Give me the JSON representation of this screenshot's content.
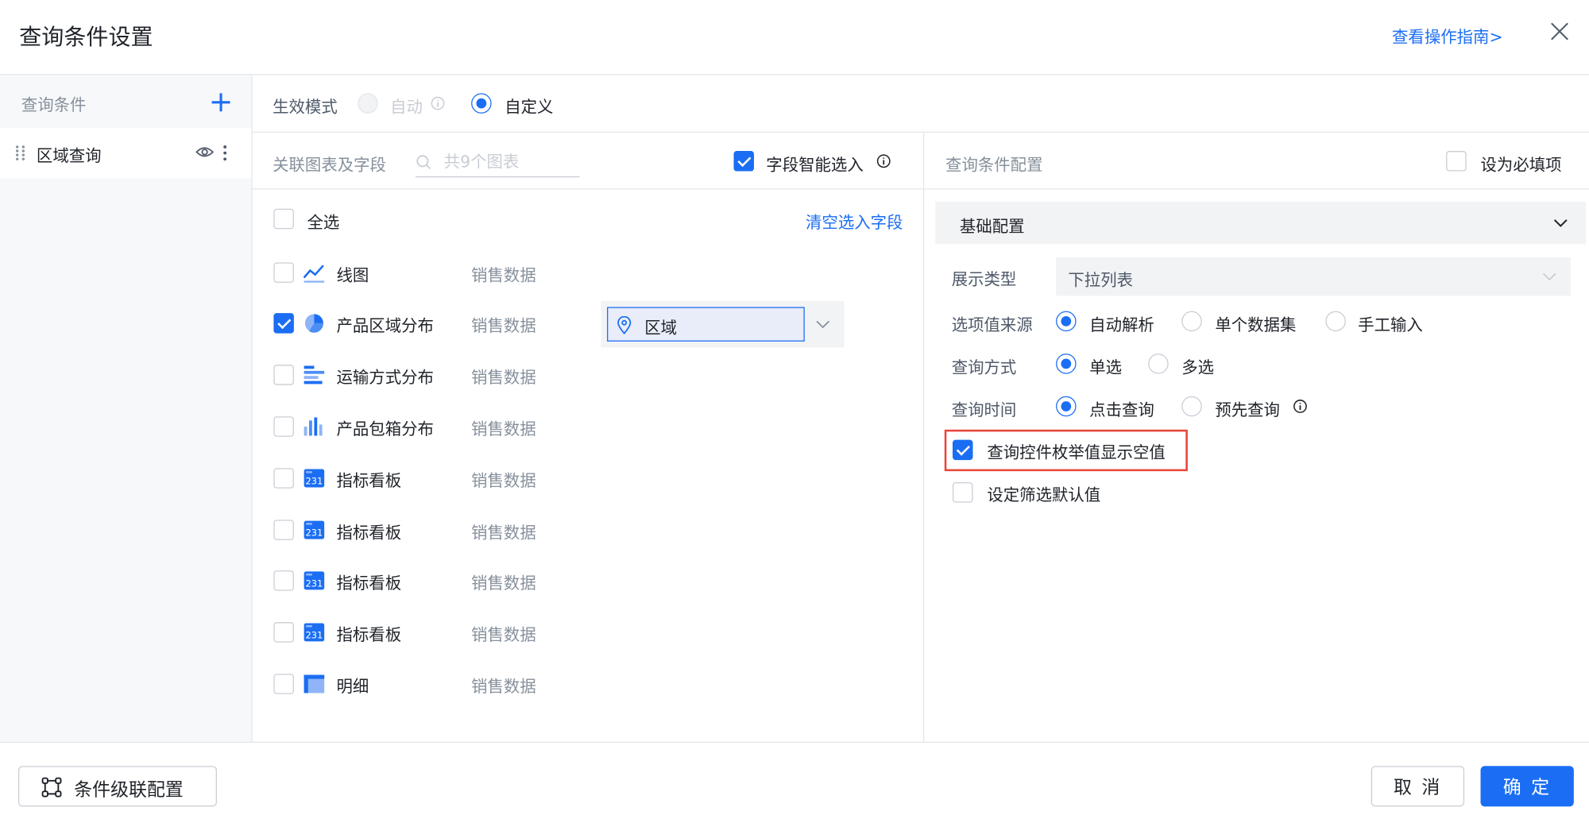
{
  "dialog": {
    "title": "查询条件设置",
    "guide_link": "查看操作指南>"
  },
  "sidebar": {
    "header": "查询条件",
    "items": [
      {
        "label": "区域查询"
      }
    ]
  },
  "mode": {
    "label": "生效模式",
    "options": [
      {
        "label": "自动",
        "disabled": true
      },
      {
        "label": "自定义",
        "selected": true
      }
    ]
  },
  "charts_panel": {
    "header": "关联图表及字段",
    "search_placeholder": "共9个图表",
    "smart_select_label": "字段智能选入",
    "select_all": "全选",
    "clear_fields": "清空选入字段",
    "rows": [
      {
        "name": "线图",
        "dataset": "销售数据",
        "checked": false,
        "icon": "line-chart-icon"
      },
      {
        "name": "产品区域分布",
        "dataset": "销售数据",
        "checked": true,
        "icon": "pie-chart-icon"
      },
      {
        "name": "运输方式分布",
        "dataset": "销售数据",
        "checked": false,
        "icon": "bar-h-chart-icon"
      },
      {
        "name": "产品包箱分布",
        "dataset": "销售数据",
        "checked": false,
        "icon": "bar-chart-icon"
      },
      {
        "name": "指标看板",
        "dataset": "销售数据",
        "checked": false,
        "icon": "kpi-board-icon"
      },
      {
        "name": "指标看板",
        "dataset": "销售数据",
        "checked": false,
        "icon": "kpi-board-icon"
      },
      {
        "name": "指标看板",
        "dataset": "销售数据",
        "checked": false,
        "icon": "kpi-board-icon"
      },
      {
        "name": "指标看板",
        "dataset": "销售数据",
        "checked": false,
        "icon": "kpi-board-icon"
      },
      {
        "name": "明细",
        "dataset": "销售数据",
        "checked": false,
        "icon": "table-icon"
      }
    ],
    "selected_field": "区域"
  },
  "config_panel": {
    "header": "查询条件配置",
    "required_label": "设为必填项",
    "section_title": "基础配置",
    "display_type": {
      "label": "展示类型",
      "value": "下拉列表"
    },
    "option_source": {
      "label": "选项值来源",
      "options": [
        "自动解析",
        "单个数据集",
        "手工输入"
      ],
      "selected": "自动解析"
    },
    "query_mode": {
      "label": "查询方式",
      "options": [
        "单选",
        "多选"
      ],
      "selected": "单选"
    },
    "query_time": {
      "label": "查询时间",
      "options": [
        "点击查询",
        "预先查询"
      ],
      "selected": "点击查询"
    },
    "show_empty": {
      "label": "查询控件枚举值显示空值",
      "checked": true
    },
    "default_value": {
      "label": "设定筛选默认值",
      "checked": false
    }
  },
  "footer": {
    "cascade_label": "条件级联配置",
    "cancel_label": "取 消",
    "ok_label": "确 定"
  },
  "colors": {
    "primary": "#1b6ef3",
    "highlight_border": "#e8463a"
  }
}
